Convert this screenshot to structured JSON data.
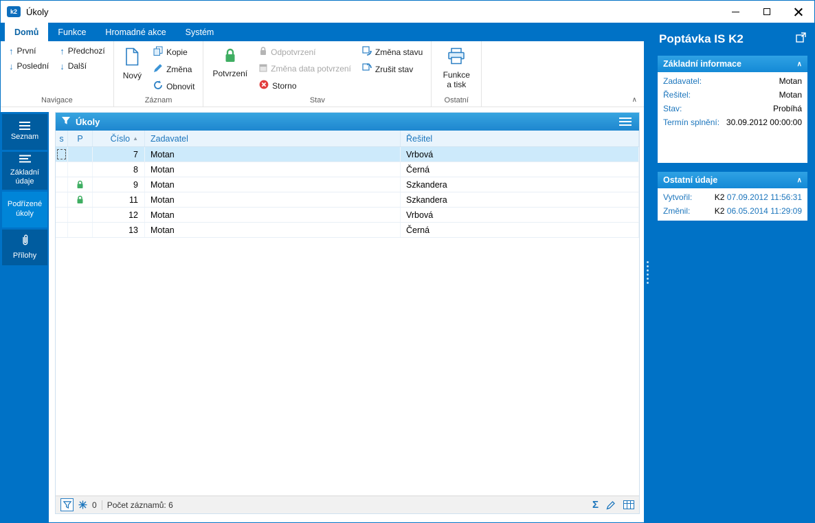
{
  "window": {
    "title": "Úkoly",
    "icon_text": "k2"
  },
  "ribbon": {
    "tabs": [
      {
        "label": "Domů",
        "active": true
      },
      {
        "label": "Funkce",
        "active": false
      },
      {
        "label": "Hromadné akce",
        "active": false
      },
      {
        "label": "Systém",
        "active": false
      }
    ],
    "nav": {
      "group": "Navigace",
      "prvni": "První",
      "posledni": "Poslední",
      "predchozi": "Předchozí",
      "dalsi": "Další"
    },
    "zaznam": {
      "group": "Záznam",
      "novy": "Nový",
      "kopie": "Kopie",
      "zmena": "Změna",
      "obnovit": "Obnovit"
    },
    "stav": {
      "group": "Stav",
      "potvrzeni": "Potvrzení",
      "odpotvrzeni": "Odpotvrzení",
      "zmena_data": "Změna data potvrzení",
      "storno": "Storno",
      "zmena_stavu": "Změna stavu",
      "zrusit_stav": "Zrušit stav"
    },
    "ostatni": {
      "group": "Ostatní",
      "funkce_tisk": "Funkce a tisk"
    }
  },
  "sidebar": {
    "items": [
      {
        "label": "Seznam",
        "icon": "menu-icon",
        "active": false
      },
      {
        "label": "Základní údaje",
        "icon": "list-details-icon",
        "active": false
      },
      {
        "label": "Podřízené úkoly",
        "icon": "none",
        "active": true
      },
      {
        "label": "Přílohy",
        "icon": "paperclip-icon",
        "active": false
      }
    ]
  },
  "table": {
    "title": "Úkoly",
    "columns": {
      "s": "s",
      "p": "P",
      "cislo": "Číslo",
      "zadavatel": "Zadavatel",
      "resitel": "Řešitel"
    },
    "sort_column": "Číslo",
    "rows": [
      {
        "cislo": "7",
        "zadavatel": "Motan",
        "resitel": "Vrbová",
        "selected": true,
        "locked": false
      },
      {
        "cislo": "8",
        "zadavatel": "Motan",
        "resitel": "Černá",
        "selected": false,
        "locked": false
      },
      {
        "cislo": "9",
        "zadavatel": "Motan",
        "resitel": "Szkandera",
        "selected": false,
        "locked": true
      },
      {
        "cislo": "11",
        "zadavatel": "Motan",
        "resitel": "Szkandera",
        "selected": false,
        "locked": true
      },
      {
        "cislo": "12",
        "zadavatel": "Motan",
        "resitel": "Vrbová",
        "selected": false,
        "locked": false
      },
      {
        "cislo": "13",
        "zadavatel": "Motan",
        "resitel": "Černá",
        "selected": false,
        "locked": false
      }
    ],
    "footer": {
      "freeze_count": "0",
      "records": "Počet záznamů: 6"
    }
  },
  "detail": {
    "title": "Poptávka IS K2",
    "sections": [
      {
        "title": "Základní informace",
        "fields": [
          {
            "label": "Zadavatel:",
            "value": "Motan"
          },
          {
            "label": "Řešitel:",
            "value": "Motan"
          },
          {
            "label": "Stav:",
            "value": "Probíhá"
          },
          {
            "label": "Termín splnění:",
            "value": "30.09.2012 00:00:00"
          }
        ]
      },
      {
        "title": "Ostatní údaje",
        "fields": [
          {
            "label": "Vytvořil:",
            "user": "K2",
            "value": "07.09.2012 11:56:31"
          },
          {
            "label": "Změnil:",
            "user": "K2",
            "value": "06.05.2014 11:29:09"
          }
        ]
      }
    ]
  },
  "colors": {
    "accent": "#0072c6",
    "link": "#1b75bc",
    "lock_green": "#3fae62",
    "storno_red": "#e23c3c",
    "selected_row": "#cdeafb"
  }
}
